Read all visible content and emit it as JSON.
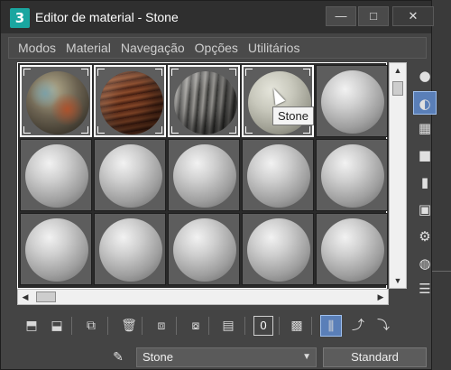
{
  "window": {
    "title": "Editor de material - Stone",
    "app_icon_label": "3",
    "controls": {
      "minimize": "—",
      "maximize": "□",
      "close": "✕"
    }
  },
  "menu": [
    "Modos",
    "Material",
    "Navegação",
    "Opções",
    "Utilitários"
  ],
  "slots": {
    "rows": [
      [
        {
          "material": "mat1",
          "active": true
        },
        {
          "material": "mat2",
          "active": true
        },
        {
          "material": "mat3",
          "active": true
        },
        {
          "material": "stone",
          "active": true
        },
        {
          "material": "default",
          "active": false
        }
      ],
      [
        {
          "material": "default",
          "active": false
        },
        {
          "material": "default",
          "active": false
        },
        {
          "material": "default",
          "active": false
        },
        {
          "material": "default",
          "active": false
        },
        {
          "material": "default",
          "active": false
        }
      ],
      [
        {
          "material": "default",
          "active": false
        },
        {
          "material": "default",
          "active": false
        },
        {
          "material": "default",
          "active": false
        },
        {
          "material": "default",
          "active": false
        },
        {
          "material": "default",
          "active": false
        }
      ]
    ],
    "tooltip": "Stone"
  },
  "side_toolbar": [
    {
      "name": "sample-type-icon",
      "glyph": "●"
    },
    {
      "name": "backlight-icon",
      "glyph": "◐",
      "active": true
    },
    {
      "name": "background-checker-icon",
      "glyph": "▦"
    },
    {
      "name": "uv-tiling-icon",
      "glyph": "■"
    },
    {
      "name": "video-color-check-icon",
      "glyph": "▮"
    },
    {
      "name": "make-preview-icon",
      "glyph": "▣"
    },
    {
      "name": "options-icon",
      "glyph": "⚙"
    },
    {
      "name": "select-by-material-icon",
      "glyph": "◍"
    },
    {
      "name": "material-map-navigator-icon",
      "glyph": "☰"
    }
  ],
  "bottom_toolbar": {
    "zero_label": "0",
    "buttons": [
      {
        "name": "get-material-icon",
        "glyph": "⬒"
      },
      {
        "name": "put-to-scene-icon",
        "glyph": "⬓"
      },
      {
        "name": "assign-to-selection-icon",
        "glyph": "⧉"
      },
      {
        "name": "reset-map-icon",
        "glyph": "🗑"
      },
      {
        "name": "copy-material-icon",
        "glyph": "⧈"
      },
      {
        "name": "make-unique-icon",
        "glyph": "⧇"
      },
      {
        "name": "put-to-library-icon",
        "glyph": "▤"
      },
      {
        "name": "material-id-channel-icon",
        "glyph": "0"
      },
      {
        "name": "show-shaded-material-icon",
        "glyph": "▩"
      },
      {
        "name": "show-end-result-icon",
        "glyph": "⫼",
        "active": true
      },
      {
        "name": "go-to-parent-icon",
        "glyph": "⤴"
      },
      {
        "name": "go-forward-to-sibling-icon",
        "glyph": "⤵"
      }
    ]
  },
  "material_name": "Stone",
  "material_type": "Standard",
  "colors": {
    "window_bg": "#444444",
    "titlebar": "#2f2f2f",
    "active_tool": "#5a7fb8"
  }
}
